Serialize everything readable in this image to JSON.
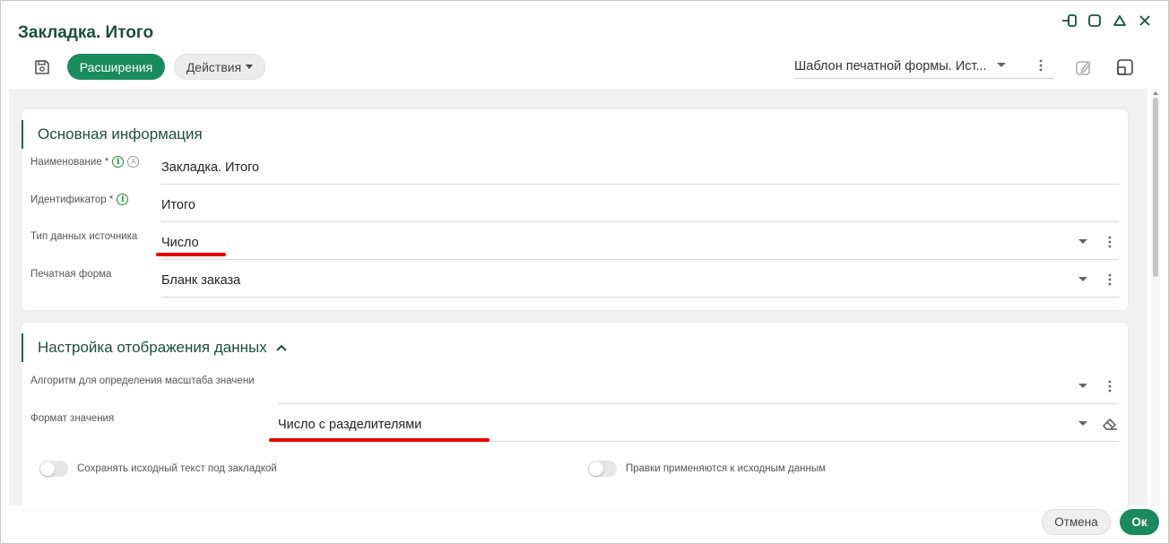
{
  "window": {
    "title": "Закладка. Итого",
    "accent_color": "#1a8a5f"
  },
  "toolbar": {
    "extensions_label": "Расширения",
    "actions_label": "Действия",
    "template_value": "Шаблон печатной формы. Ист..."
  },
  "main_info": {
    "section_title": "Основная информация",
    "fields": [
      {
        "label": "Наименование *",
        "value": "Закладка. Итого"
      },
      {
        "label": "Идентификатор *",
        "value": "Итого"
      },
      {
        "label": "Тип данных источника",
        "value": "Число"
      },
      {
        "label": "Печатная форма",
        "value": "Бланк заказа"
      }
    ]
  },
  "display_settings": {
    "section_title": "Настройка отображения данных",
    "fields": [
      {
        "label": "Алгоритм для определения масштаба значени",
        "value": ""
      },
      {
        "label": "Формат значения",
        "value": "Число с разделителями"
      }
    ],
    "toggles": [
      {
        "label": "Сохранять исходный текст под закладкой",
        "on": false
      },
      {
        "label": "Правки применяются к исходным данным",
        "on": false
      }
    ]
  },
  "footer": {
    "cancel_label": "Отмена",
    "ok_label": "Ок"
  },
  "annotation_color": "#e80000"
}
